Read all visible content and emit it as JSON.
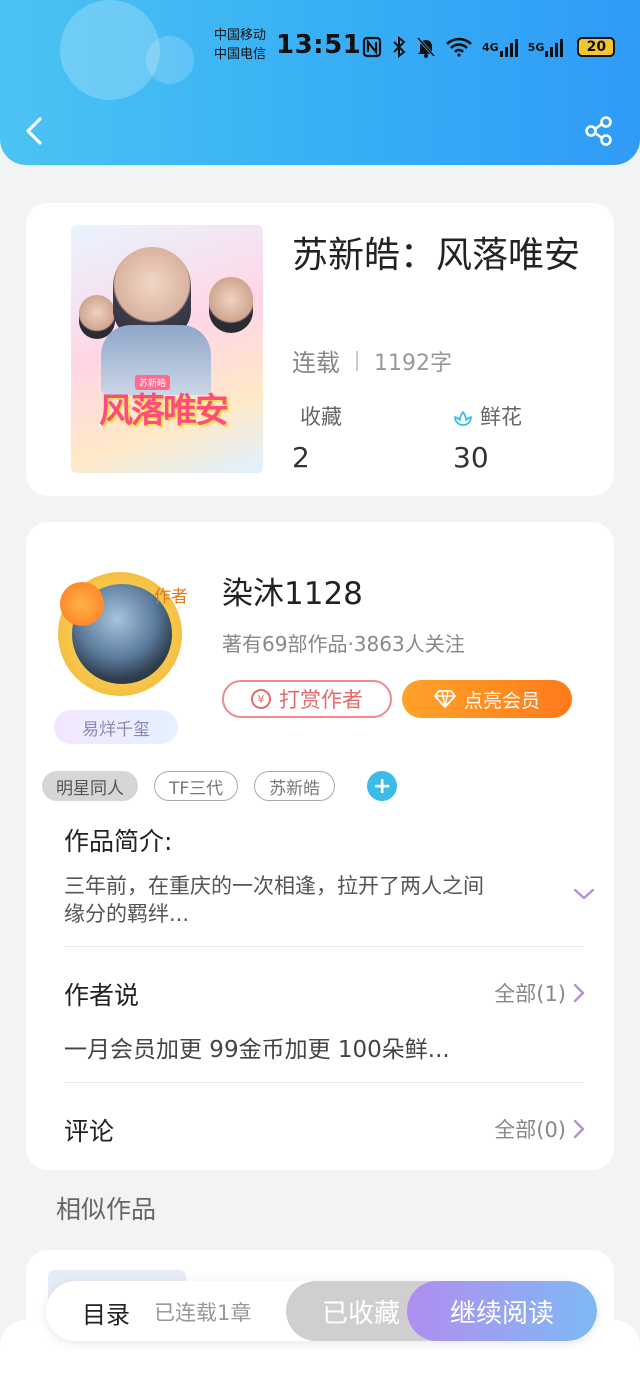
{
  "status_bar": {
    "carrier1": "中国移动",
    "carrier2": "中国电信",
    "time": "13:51",
    "net1": "4G",
    "net2": "5G",
    "battery": "20"
  },
  "book": {
    "title": "苏新皓：风落唯安",
    "status": "连载",
    "word_count": "1192字",
    "collect_label": "收藏",
    "collect_value": "2",
    "flower_label": "鲜花",
    "flower_value": "30",
    "cover_title": "风落唯安",
    "cover_tag": "苏新皓"
  },
  "author": {
    "badge": "作者",
    "name": "染沐1128",
    "info": "著有69部作品·3863人关注",
    "fan_tag": "易烊千玺",
    "tip_label": "打赏作者",
    "tip_coin": "¥",
    "vip_label": "点亮会员"
  },
  "tags": [
    "明星同人",
    "TF三代",
    "苏新皓"
  ],
  "tag_add": "+",
  "intro": {
    "title": "作品简介:",
    "line1": "三年前，在重庆的一次相逢，拉开了两人之间",
    "line2": "缘分的羁绊..."
  },
  "author_says": {
    "title": "作者说",
    "more": "全部(1)",
    "body": "一月会员加更 99金币加更 100朵鲜..."
  },
  "comments": {
    "title": "评论",
    "more": "全部(0)"
  },
  "similar": {
    "title": "相似作品"
  },
  "bottom": {
    "toc": "目录",
    "chapters": "已连载1章",
    "collected": "已收藏",
    "read": "继续阅读"
  },
  "colors": {
    "header_start": "#4cc3f2",
    "header_end": "#2f9bf7",
    "vip_orange": "#ff8a1f",
    "tip_red": "#e56b6b",
    "read_gradient_start": "#b08ef0",
    "read_gradient_end": "#7fb9f4",
    "tag_add": "#3cbbe8"
  }
}
